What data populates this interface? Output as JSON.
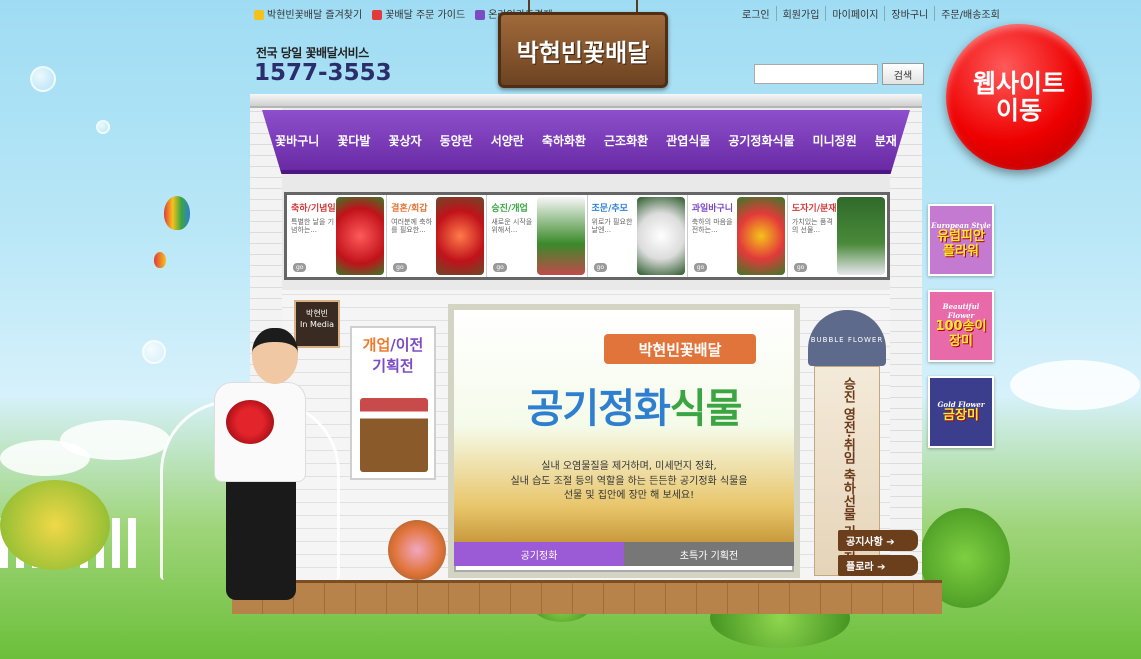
{
  "util_left": [
    {
      "label": "박현빈꽃배달 즐겨찾기",
      "icon": "star-icon",
      "color": "#f5c21b"
    },
    {
      "label": "꽃배달 주문 가이드",
      "icon": "question-icon",
      "color": "#e23a3a"
    },
    {
      "label": "온라인카드결제",
      "icon": "card-icon",
      "color": "#7b4bc4"
    }
  ],
  "util_right": [
    "로그인",
    "회원가입",
    "마이페이지",
    "장바구니",
    "주문/배송조회"
  ],
  "tagline": "전국 당일 꽃배달서비스",
  "phone": "1577-3553",
  "logo": "박현빈꽃배달",
  "search": {
    "placeholder": "",
    "button": "검색"
  },
  "website_button": [
    "웹사이트",
    "이동"
  ],
  "nav": [
    "꽃바구니",
    "꽃다발",
    "꽃상자",
    "동양란",
    "서양란",
    "축하화환",
    "근조화환",
    "관엽식물",
    "공기정화식물",
    "미니정원",
    "분재"
  ],
  "categories": [
    {
      "title": "축하/기념일",
      "desc": "특별한 날을 기념하는...",
      "color": "#d43a3a",
      "go": "go"
    },
    {
      "title": "결혼/회갑",
      "desc": "여러분께 축하를 필요한...",
      "color": "#e0743a",
      "go": "go"
    },
    {
      "title": "승진/개업",
      "desc": "새로운 시작을 위해서...",
      "color": "#3aa542",
      "go": "go"
    },
    {
      "title": "조문/추모",
      "desc": "위로가 필요한 날엔...",
      "color": "#2f7fd1",
      "go": "go"
    },
    {
      "title": "과일바구니",
      "desc": "축하의 마음을 전하는...",
      "color": "#7b4bc4",
      "go": "go"
    },
    {
      "title": "도자기/분재",
      "desc": "가치있는 품격의 선물...",
      "color": "#d43a3a",
      "go": "go"
    }
  ],
  "media_sign": [
    "박현빈",
    "In Media"
  ],
  "open_poster": {
    "a": "개업",
    "sep": "/",
    "b": "이전",
    "c": "기획전"
  },
  "main_banner": {
    "brand": "박현빈꽃배달",
    "title_a": "공기정화",
    "title_b": "식물",
    "desc_lines": [
      "실내 오염물질을 제거하며, 미세먼지 정화,",
      "실내 습도 조절 등의 역할을 하는 든든한 공기정화 식물을",
      "선물 및 집안에 장만 해 보세요!"
    ],
    "tabs": [
      "공기정화",
      "초특가 기획전"
    ]
  },
  "bubble_sign": {
    "top": "BUBBLE FLOWER",
    "text": "승진 영전·취임 축하선물 기획전"
  },
  "signpost": [
    "공지사항 ➔",
    "플로라 ➔"
  ],
  "side_ads": [
    {
      "small": "European Style",
      "big": "유럽피안 플라워",
      "bg": "#c57ad1"
    },
    {
      "small": "Beautiful Flower",
      "big": "100송이 장미",
      "bg": "#e86aa8"
    },
    {
      "small": "Gold Flower",
      "big": "금장미",
      "bg": "#3a3e8c"
    }
  ]
}
